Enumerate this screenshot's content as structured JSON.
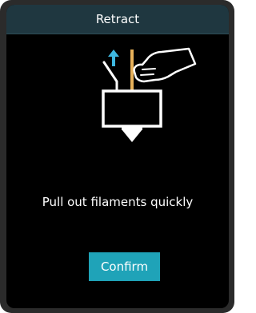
{
  "dialog": {
    "title": "Retract",
    "message": "Pull out filaments quickly",
    "confirm_label": "Confirm"
  },
  "illustration": {
    "icons": [
      "up-arrow-icon",
      "hand-icon",
      "filament-icon",
      "extruder-icon"
    ]
  },
  "colors": {
    "title_bar": "#1f3740",
    "accent": "#1fa3b8",
    "filament": "#e8b25a",
    "arrow": "#3eb7e0",
    "background": "#000000",
    "text": "#ffffff"
  }
}
